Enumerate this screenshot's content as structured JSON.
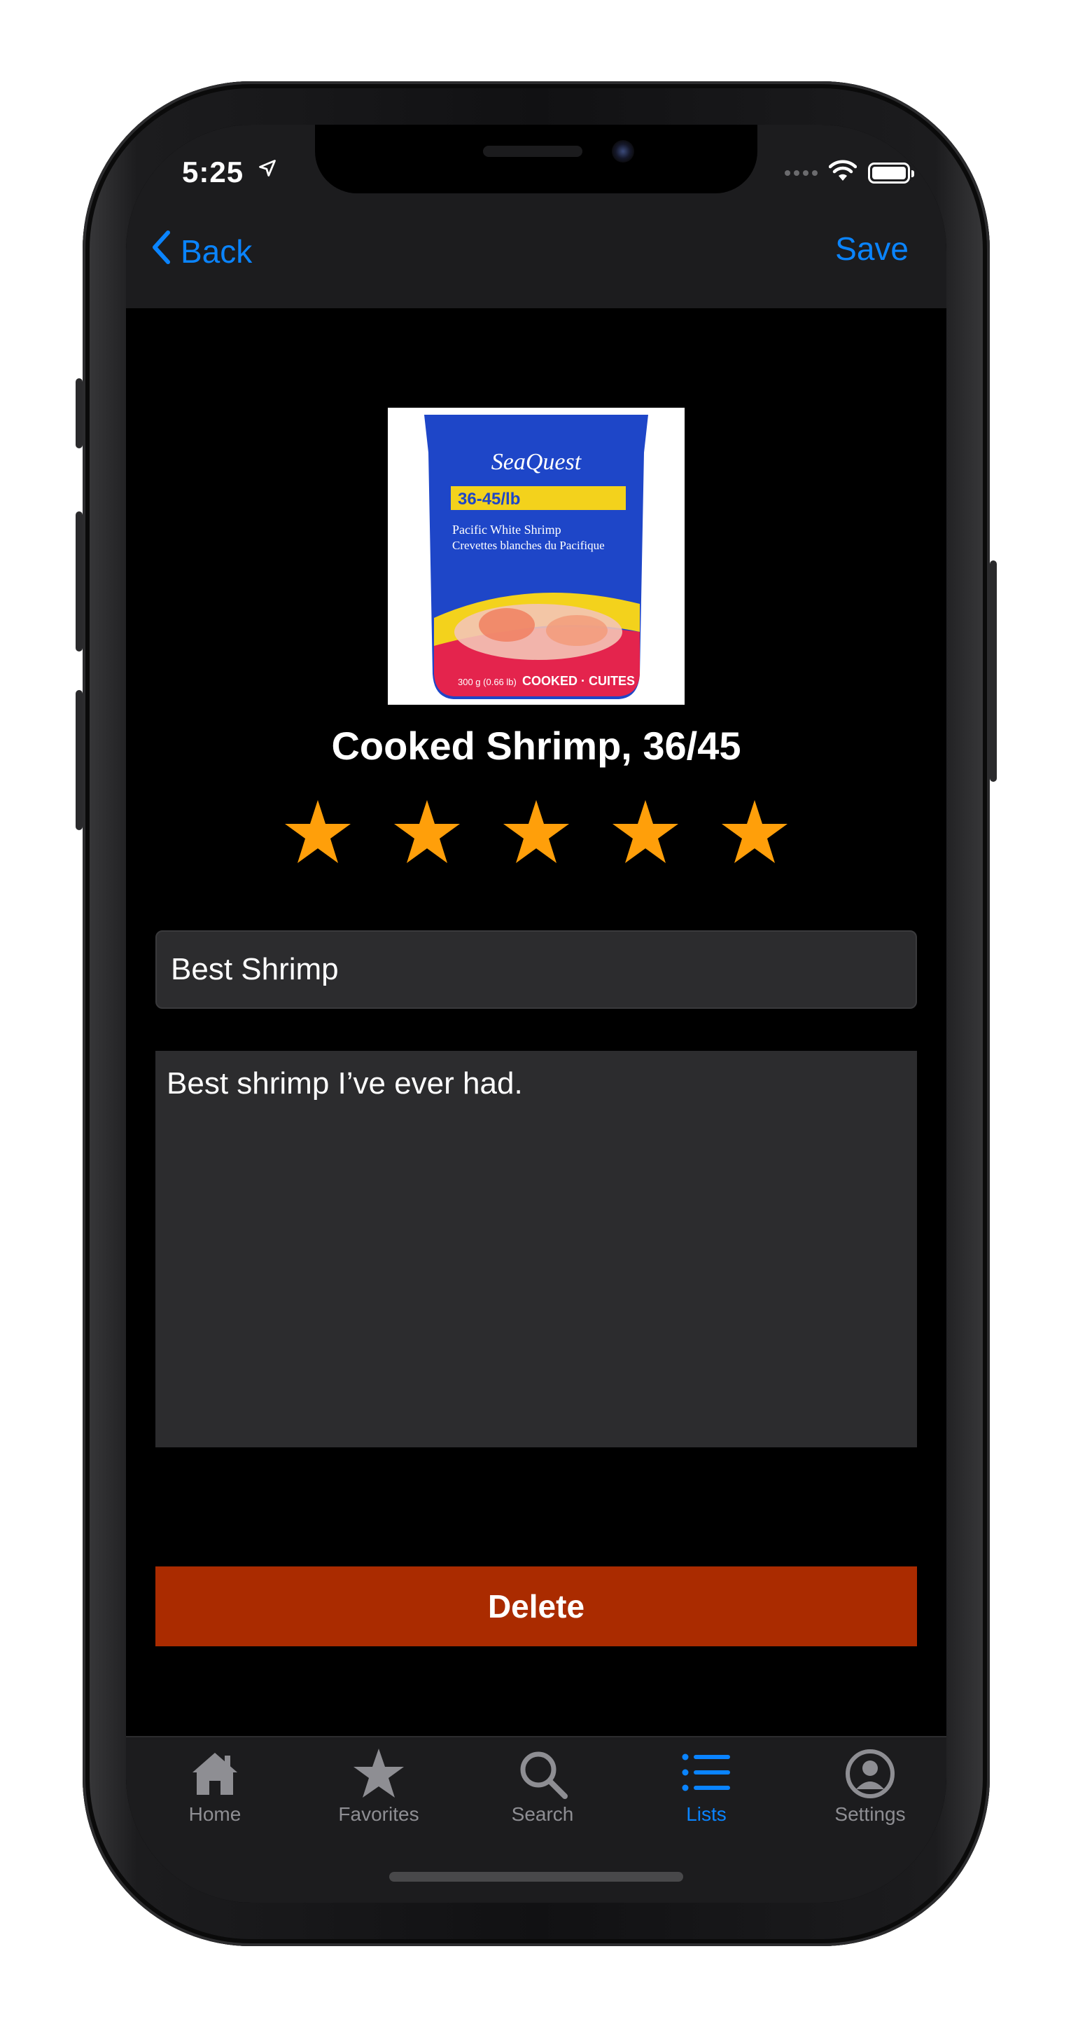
{
  "status_bar": {
    "time": "5:25",
    "location_icon": "location-arrow-icon",
    "wifi_icon": "wifi-icon",
    "battery_icon": "battery-icon"
  },
  "nav": {
    "back_label": "Back",
    "save_label": "Save"
  },
  "product": {
    "name": "Cooked Shrimp, 36/45",
    "image": {
      "brand": "SeaQuest",
      "count": "36-45/lb",
      "line1": "Pacific White Shrimp",
      "line2": "Crevettes blanches du Pacifique",
      "weight": "300 g (0.66 lb)",
      "cooked": "COOKED · CUITES"
    },
    "rating": 5,
    "rating_max": 5
  },
  "review": {
    "title_value": "Best Shrimp",
    "notes_value": "Best shrimp I’ve ever had."
  },
  "actions": {
    "delete_label": "Delete"
  },
  "tabs": [
    {
      "label": "Home",
      "icon": "home-icon",
      "active": false
    },
    {
      "label": "Favorites",
      "icon": "star-icon",
      "active": false
    },
    {
      "label": "Search",
      "icon": "search-icon",
      "active": false
    },
    {
      "label": "Lists",
      "icon": "list-icon",
      "active": true
    },
    {
      "label": "Settings",
      "icon": "person-circle-icon",
      "active": false
    }
  ],
  "colors": {
    "accent": "#0a84ff",
    "star": "#ff9f0a",
    "delete": "#aa2b00",
    "background": "#000000",
    "field": "#2c2c2e"
  }
}
